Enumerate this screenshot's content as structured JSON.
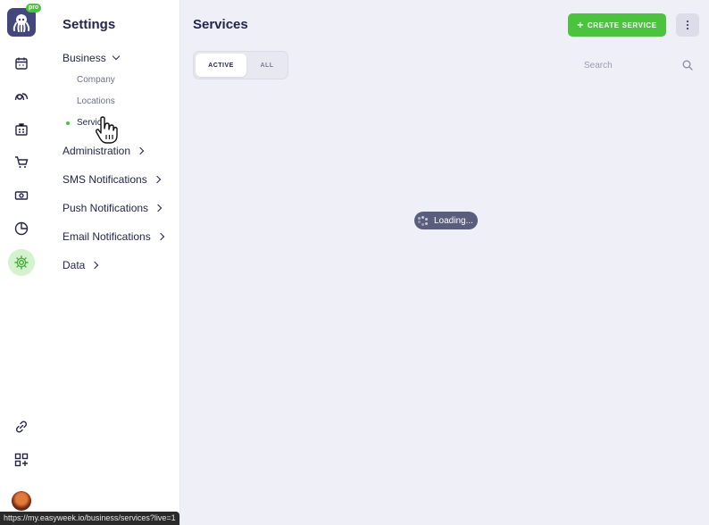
{
  "rail": {
    "pro_badge": "pro",
    "icons": [
      "calendar-icon",
      "clients-icon",
      "business-icon",
      "cart-icon",
      "money-icon",
      "reports-icon",
      "settings-icon",
      "link-icon",
      "apps-icon"
    ],
    "active_icon": "settings-icon",
    "accent_color": "#4cc33f"
  },
  "settings": {
    "title": "Settings",
    "groups": {
      "business": "Business",
      "administration": "Administration",
      "sms": "SMS Notifications",
      "push": "Push Notifications",
      "email": "Email Notifications",
      "data": "Data"
    },
    "business_items": {
      "company": "Company",
      "locations": "Locations",
      "services": "Servic"
    }
  },
  "main": {
    "title": "Services",
    "create_button": "+ CREATE SERVICE",
    "create_label": "CREATE SERVICE",
    "create_plus": "+",
    "tabs": {
      "active": "ACTIVE",
      "all": "ALL"
    },
    "search_placeholder": "Search",
    "loading": "Loading..."
  },
  "status_url": "https://my.easyweek.io/business/services?live=1"
}
